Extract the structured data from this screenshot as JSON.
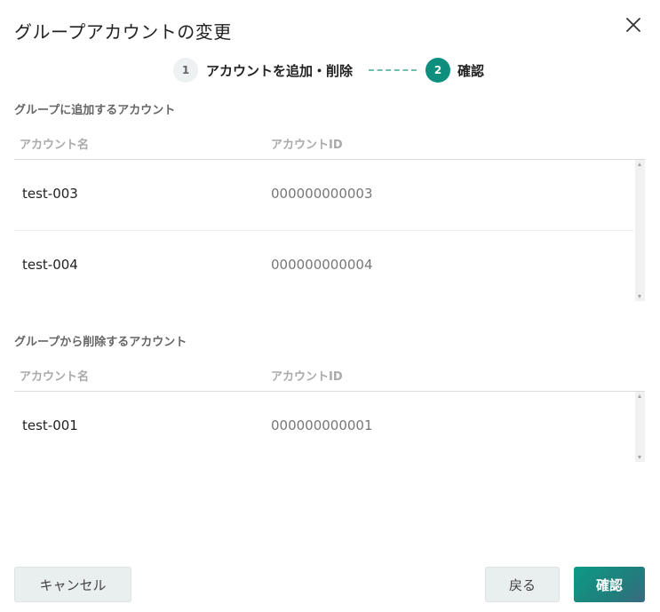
{
  "dialog": {
    "title": "グループアカウントの変更",
    "close_icon": "close-icon"
  },
  "stepper": {
    "steps": [
      {
        "number": "1",
        "label": "アカウントを追加・削除",
        "state": "done"
      },
      {
        "number": "2",
        "label": "確認",
        "state": "active"
      }
    ],
    "active_color": "#0e8f7e",
    "connector_color": "#6fbfae"
  },
  "add_section": {
    "title": "グループに追加するアカウント",
    "columns": [
      "アカウント名",
      "アカウントID"
    ],
    "rows": [
      {
        "name": "test-003",
        "id": "000000000003"
      },
      {
        "name": "test-004",
        "id": "000000000004"
      }
    ]
  },
  "remove_section": {
    "title": "グループから削除するアカウント",
    "columns": [
      "アカウント名",
      "アカウントID"
    ],
    "rows": [
      {
        "name": "test-001",
        "id": "000000000001"
      }
    ]
  },
  "footer": {
    "cancel_label": "キャンセル",
    "back_label": "戻る",
    "confirm_label": "確認"
  }
}
